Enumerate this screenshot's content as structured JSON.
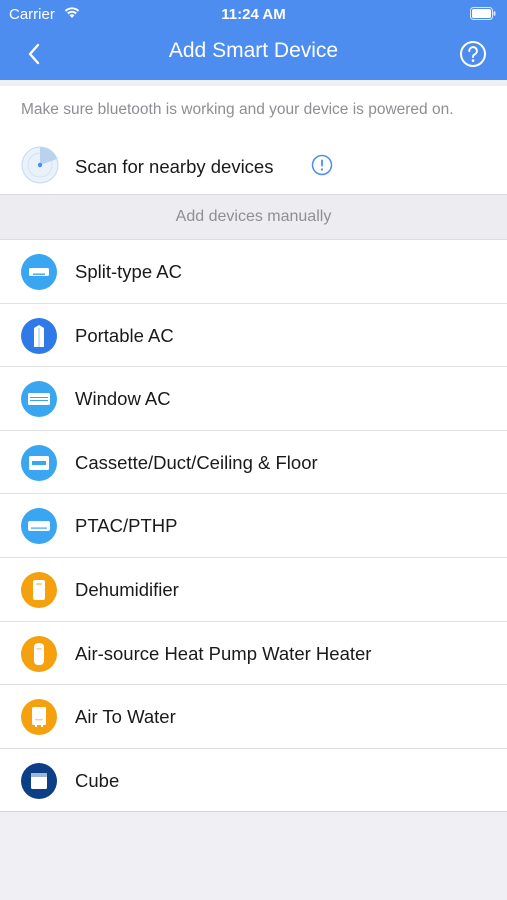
{
  "status_bar": {
    "carrier": "Carrier",
    "time": "11:24 AM",
    "icons": [
      "wifi-icon",
      "battery-icon"
    ]
  },
  "nav": {
    "title": "Add Smart Device",
    "back_icon": "chevron-left-icon",
    "help_icon": "question-circle-icon"
  },
  "scan": {
    "hint": "Make sure bluetooth is working and your device is powered on.",
    "label": "Scan for nearby devices",
    "icon": "radar-icon",
    "info_icon": "info-circle-icon"
  },
  "manual_section": {
    "header": "Add devices manually"
  },
  "devices": [
    {
      "label": "Split-type AC",
      "icon": "split-ac-icon",
      "color": "#3aa6f2"
    },
    {
      "label": "Portable AC",
      "icon": "portable-ac-icon",
      "color": "#2f7ae6"
    },
    {
      "label": "Window AC",
      "icon": "window-ac-icon",
      "color": "#3aa6f2"
    },
    {
      "label": "Cassette/Duct/Ceiling & Floor",
      "icon": "cassette-ac-icon",
      "color": "#3aa6f2"
    },
    {
      "label": "PTAC/PTHP",
      "icon": "ptac-icon",
      "color": "#3aa6f2"
    },
    {
      "label": "Dehumidifier",
      "icon": "dehumidifier-icon",
      "color": "#f5a00f"
    },
    {
      "label": "Air-source Heat Pump Water Heater",
      "icon": "water-heater-icon",
      "color": "#f5a00f"
    },
    {
      "label": "Air To Water",
      "icon": "air-to-water-icon",
      "color": "#f5a00f"
    },
    {
      "label": "Cube",
      "icon": "cube-icon",
      "color": "#0d3f87"
    }
  ],
  "colors": {
    "accent": "#4d8df0",
    "background": "#efeff4"
  }
}
